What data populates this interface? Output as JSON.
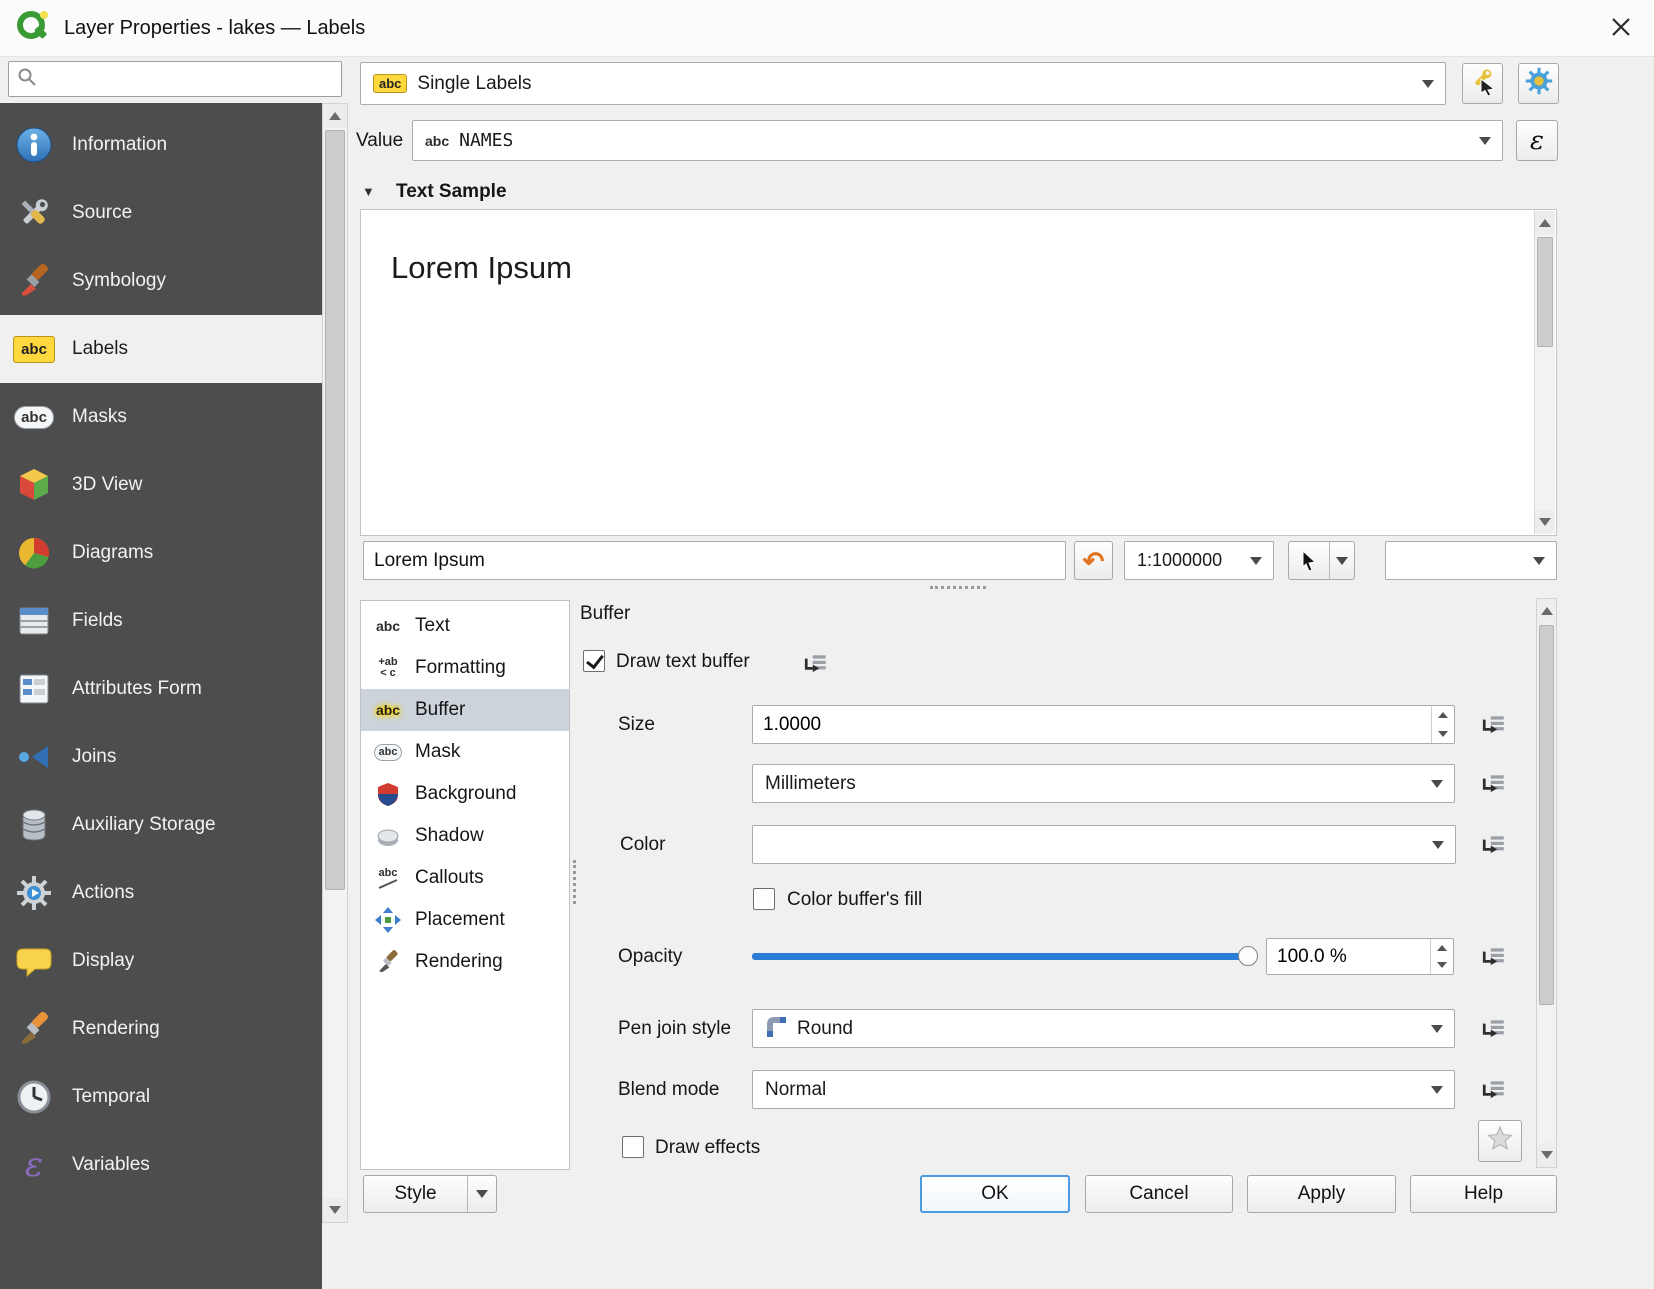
{
  "window": {
    "title": "Layer Properties - lakes — Labels"
  },
  "sidebar": {
    "search_value": "",
    "items": [
      {
        "label": "Information"
      },
      {
        "label": "Source"
      },
      {
        "label": "Symbology"
      },
      {
        "label": "Labels",
        "selected": true
      },
      {
        "label": "Masks"
      },
      {
        "label": "3D View"
      },
      {
        "label": "Diagrams"
      },
      {
        "label": "Fields"
      },
      {
        "label": "Attributes Form"
      },
      {
        "label": "Joins"
      },
      {
        "label": "Auxiliary Storage"
      },
      {
        "label": "Actions"
      },
      {
        "label": "Display"
      },
      {
        "label": "Rendering"
      },
      {
        "label": "Temporal"
      },
      {
        "label": "Variables"
      }
    ]
  },
  "header": {
    "label_type": "Single Labels",
    "value_label": "Value",
    "value_field": "NAMES"
  },
  "text_sample": {
    "title": "Text Sample",
    "preview": "Lorem Ipsum",
    "input_value": "Lorem Ipsum",
    "scale": "1:1000000"
  },
  "tabs": [
    {
      "label": "Text"
    },
    {
      "label": "Formatting"
    },
    {
      "label": "Buffer",
      "selected": true
    },
    {
      "label": "Mask"
    },
    {
      "label": "Background"
    },
    {
      "label": "Shadow"
    },
    {
      "label": "Callouts"
    },
    {
      "label": "Placement"
    },
    {
      "label": "Rendering"
    }
  ],
  "buffer": {
    "title": "Buffer",
    "draw_text_buffer_label": "Draw text buffer",
    "draw_text_buffer_checked": true,
    "size_label": "Size",
    "size_value": "1.0000",
    "units_value": "Millimeters",
    "color_label": "Color",
    "color_fill_label": "Color buffer's fill",
    "color_fill_checked": false,
    "opacity_label": "Opacity",
    "opacity_value": "100.0 %",
    "opacity_percent": 100,
    "pen_join_label": "Pen join style",
    "pen_join_value": "Round",
    "blend_label": "Blend mode",
    "blend_value": "Normal",
    "draw_effects_label": "Draw effects",
    "draw_effects_checked": false
  },
  "footer": {
    "style": "Style",
    "ok": "OK",
    "cancel": "Cancel",
    "apply": "Apply",
    "help": "Help"
  },
  "icons": {
    "abc": "abc",
    "fmt_top": "+ab",
    "fmt_bottom": "< c",
    "expression": "ε",
    "undo": "↶",
    "collapse": "▼"
  },
  "colors": {
    "accent_blue": "#2a7cd4",
    "sidebar_bg": "#4d4d4d",
    "selection": "#ccd3da",
    "buffer_color_swatch": "#ffffff"
  }
}
